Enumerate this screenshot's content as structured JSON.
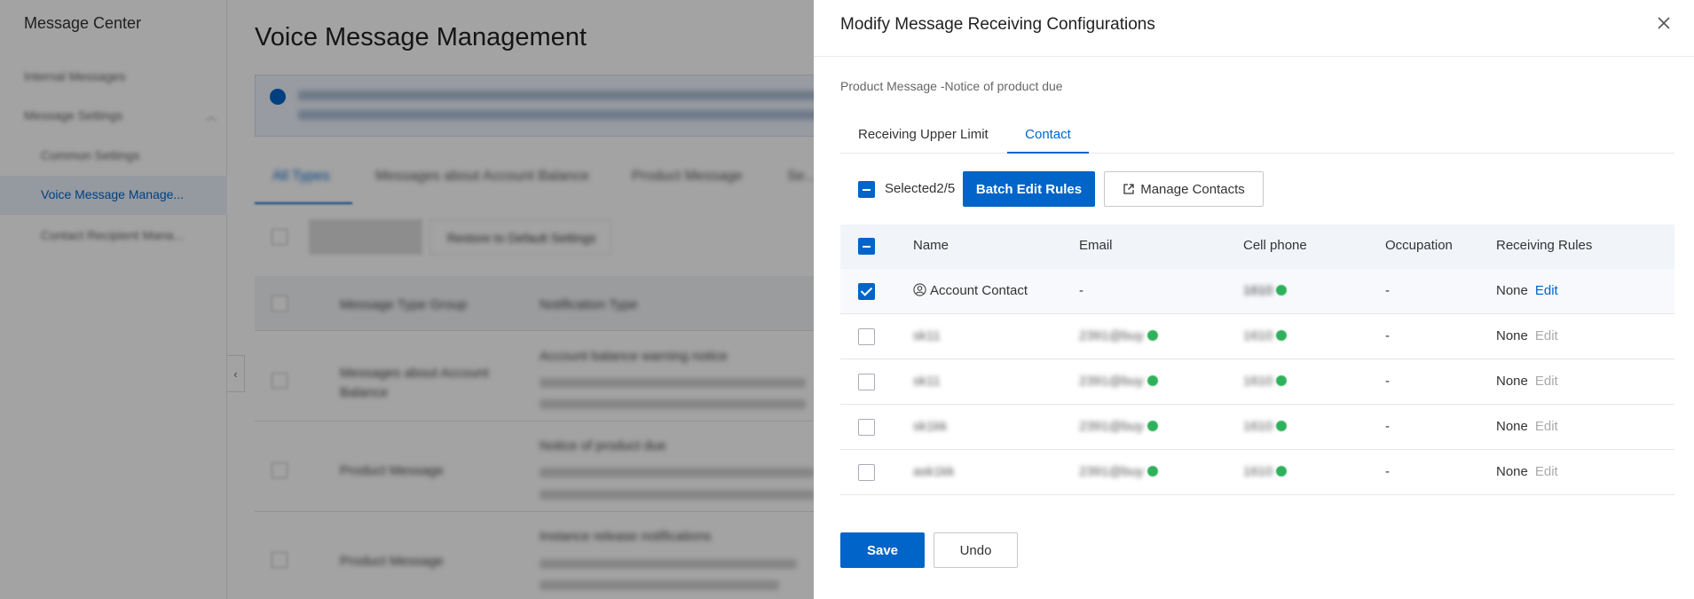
{
  "sidebar": {
    "title": "Message Center",
    "items": [
      {
        "label": "Internal Messages"
      },
      {
        "label": "Message Settings"
      },
      {
        "label": "Common Settings"
      },
      {
        "label": "Voice Message Manage..."
      },
      {
        "label": "Contact Recipient Mana..."
      }
    ]
  },
  "main": {
    "title": "Voice Message Management",
    "tabs": [
      {
        "label": "All Types"
      },
      {
        "label": "Messages about Account Balance"
      },
      {
        "label": "Product Message"
      },
      {
        "label": "Se..."
      }
    ],
    "restore_label": "Restore to Default Settings",
    "table_headers": [
      "Message Type Group",
      "Notification Type"
    ],
    "rows": [
      {
        "group": "Messages about Account Balance",
        "type": "Account balance warning notice"
      },
      {
        "group": "Product Message",
        "type": "Notice of product due"
      },
      {
        "group": "Product Message",
        "type": "Instance release notifications"
      }
    ]
  },
  "drawer": {
    "title": "Modify Message Receiving Configurations",
    "subtitle": "Product Message -Notice of product due",
    "tabs": [
      {
        "label": "Receiving Upper Limit",
        "active": false
      },
      {
        "label": "Contact",
        "active": true
      }
    ],
    "selected_text": "Selected2/5",
    "batch_edit_label": "Batch Edit Rules",
    "manage_contacts_label": "Manage Contacts",
    "table": {
      "headers": [
        "Name",
        "Email",
        "Cell phone",
        "Occupation",
        "Receiving Rules"
      ],
      "rows": [
        {
          "name": "Account Contact",
          "email": "-",
          "phone": "1610",
          "occupation": "-",
          "rule": "None",
          "edit": "Edit",
          "checked": true,
          "edit_enabled": true
        },
        {
          "name": "sk11",
          "email": "2391@buy",
          "phone": "1610",
          "occupation": "-",
          "rule": "None",
          "edit": "Edit",
          "checked": false,
          "edit_enabled": false
        },
        {
          "name": "sk11",
          "email": "2391@buy",
          "phone": "1610",
          "occupation": "-",
          "rule": "None",
          "edit": "Edit",
          "checked": false,
          "edit_enabled": false
        },
        {
          "name": "sk1kk",
          "email": "2391@buy",
          "phone": "1610",
          "occupation": "-",
          "rule": "None",
          "edit": "Edit",
          "checked": false,
          "edit_enabled": false
        },
        {
          "name": "ask1kk",
          "email": "2391@buy",
          "phone": "1610",
          "occupation": "-",
          "rule": "None",
          "edit": "Edit",
          "checked": false,
          "edit_enabled": false
        }
      ]
    },
    "save_label": "Save",
    "undo_label": "Undo"
  },
  "colors": {
    "accent": "#0064c8",
    "status_green": "#2fb15b"
  }
}
